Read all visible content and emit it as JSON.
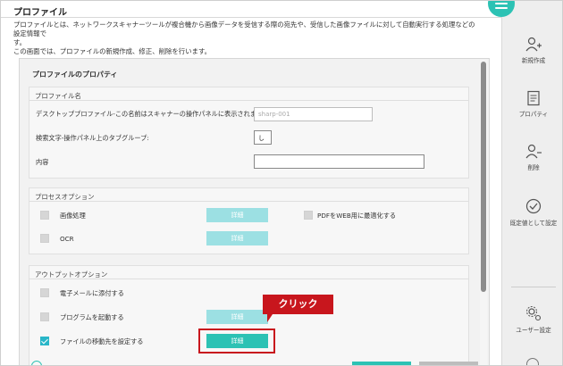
{
  "header": {
    "title": "プロファイル",
    "description_line1": "プロファイルとは、ネットワークスキャナーツールが複合機から画像データを受信する際の宛先や、受信した画像ファイルに対して自動実行する処理などの設定情報で",
    "description_line2": "す。",
    "description_line3": "この画面では、プロファイルの新規作成、修正、削除を行います。"
  },
  "panel": {
    "title": "プロファイルのプロパティ",
    "profile_name": {
      "section_title": "プロファイル名",
      "desktop_label": "デスクトッププロファイル-この名前はスキャナーの操作パネルに表示されます。",
      "desktop_value": "sharp-001",
      "search_label": "検索文字-操作パネル上のタブグループ:",
      "search_value": "し",
      "content_label": "内容",
      "content_value": ""
    },
    "process_options": {
      "section_title": "プロセスオプション",
      "image_processing": "画像処理",
      "ocr": "OCR",
      "pdf_web": "PDFをWEB用に最適化する",
      "details_label": "詳細"
    },
    "output_options": {
      "section_title": "アウトプットオプション",
      "attach_email": "電子メールに添付する",
      "launch_program": "プログラムを起動する",
      "set_destination": "ファイルの移動先を設定する",
      "details_label": "詳細"
    }
  },
  "callout": {
    "label": "クリック"
  },
  "sidebar": {
    "new": "新規作成",
    "properties": "プロパティ",
    "delete": "削除",
    "set_default": "既定値として設定",
    "user_settings": "ユーザー設定"
  },
  "colors": {
    "accent": "#2cc2b4",
    "accent_light": "#9ce0e3",
    "callout": "#c8161d",
    "checkbox_on": "#29b6c8"
  }
}
